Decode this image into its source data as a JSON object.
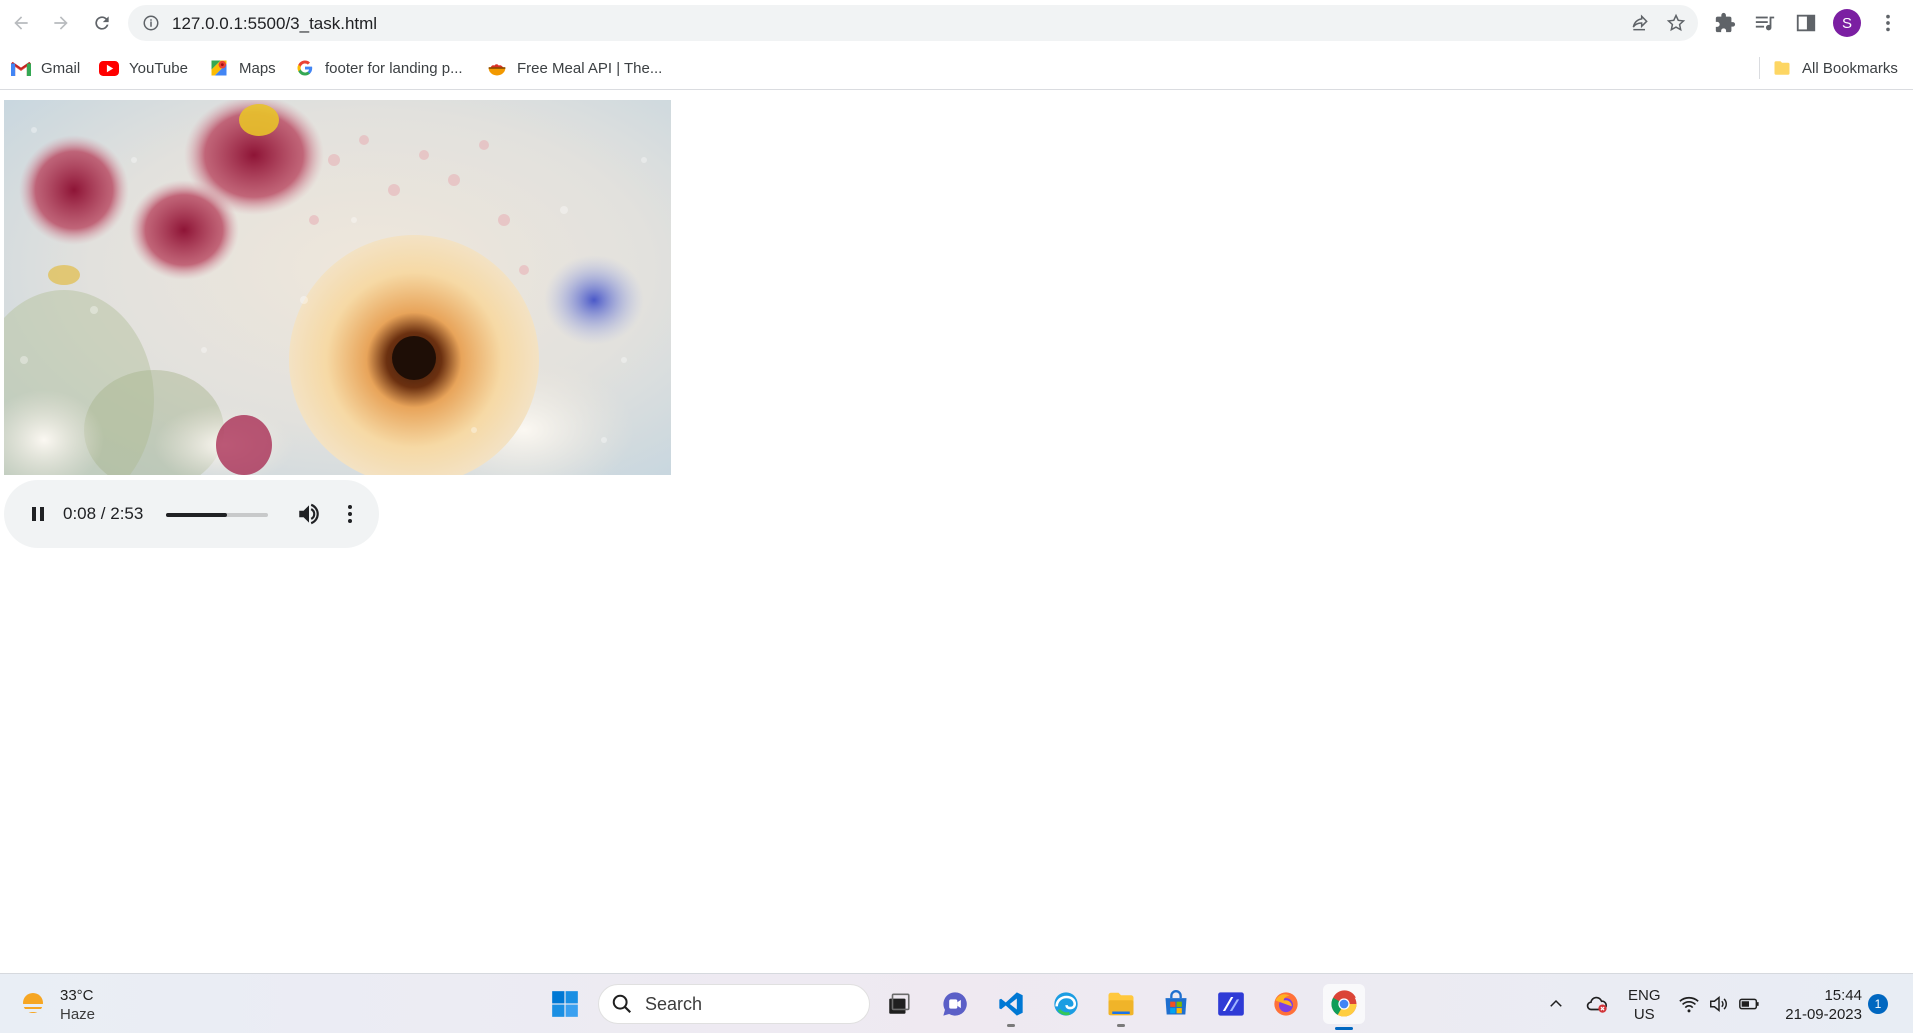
{
  "browser": {
    "url": "127.0.0.1:5500/3_task.html",
    "profile_initial": "S",
    "bookmarks": [
      {
        "label": "Gmail",
        "icon": "gmail-icon"
      },
      {
        "label": "YouTube",
        "icon": "youtube-icon"
      },
      {
        "label": "Maps",
        "icon": "maps-icon"
      },
      {
        "label": "footer for landing p...",
        "icon": "google-icon"
      },
      {
        "label": "Free Meal API | The...",
        "icon": "meal-icon"
      }
    ],
    "all_bookmarks_label": "All Bookmarks"
  },
  "page": {
    "video": {
      "subject": "flowers behind rain-covered glass"
    },
    "audio": {
      "state": "playing",
      "time_display": "0:08 / 2:53",
      "volume_level": 0.6
    }
  },
  "taskbar": {
    "weather": {
      "temp": "33°C",
      "condition": "Haze"
    },
    "search_placeholder": "Search",
    "language": {
      "line1": "ENG",
      "line2": "US"
    },
    "clock": {
      "time": "15:44",
      "date": "21-09-2023"
    },
    "notification_count": "1"
  },
  "colors": {
    "profile": "#7b1fa2",
    "accent": "#0067c0"
  }
}
